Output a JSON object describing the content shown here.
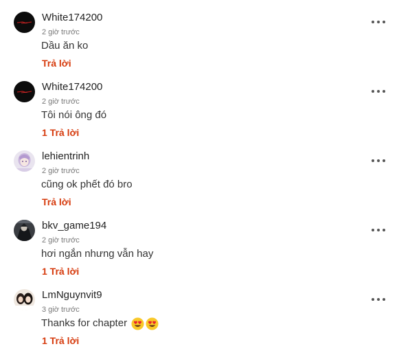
{
  "colors": {
    "reply": "#d63a0c",
    "username": "#222222",
    "meta": "#777777",
    "text": "#333333"
  },
  "comments": [
    {
      "username": "White174200",
      "time": "2 giờ trước",
      "text": "Dầu ăn ko",
      "reply_label": "Trả lời",
      "avatar_icon": "dark-red-streak-avatar",
      "menu_icon": "more-dots-icon"
    },
    {
      "username": "White174200",
      "time": "2 giờ trước",
      "text": "Tôi nói ông đó",
      "reply_label": "1 Trả lời",
      "avatar_icon": "dark-red-streak-avatar",
      "menu_icon": "more-dots-icon"
    },
    {
      "username": "lehientrinh",
      "time": "2 giờ trước",
      "text": "cũng ok phết đó bro",
      "reply_label": "Trả lời",
      "avatar_icon": "anime-girl-avatar",
      "menu_icon": "more-dots-icon"
    },
    {
      "username": "bkv_game194",
      "time": "2 giờ trước",
      "text": "hơi ngắn nhưng vẫn hay",
      "reply_label": "1 Trả lời",
      "avatar_icon": "dark-character-avatar",
      "menu_icon": "more-dots-icon"
    },
    {
      "username": "LmNguynvit9",
      "time": "3 giờ trước",
      "text": "Thanks for chapter",
      "emojis": [
        "heart-eyes-emoji",
        "heart-eyes-emoji"
      ],
      "reply_label": "1 Trả lời",
      "avatar_icon": "two-people-photo-avatar",
      "menu_icon": "more-dots-icon"
    }
  ]
}
